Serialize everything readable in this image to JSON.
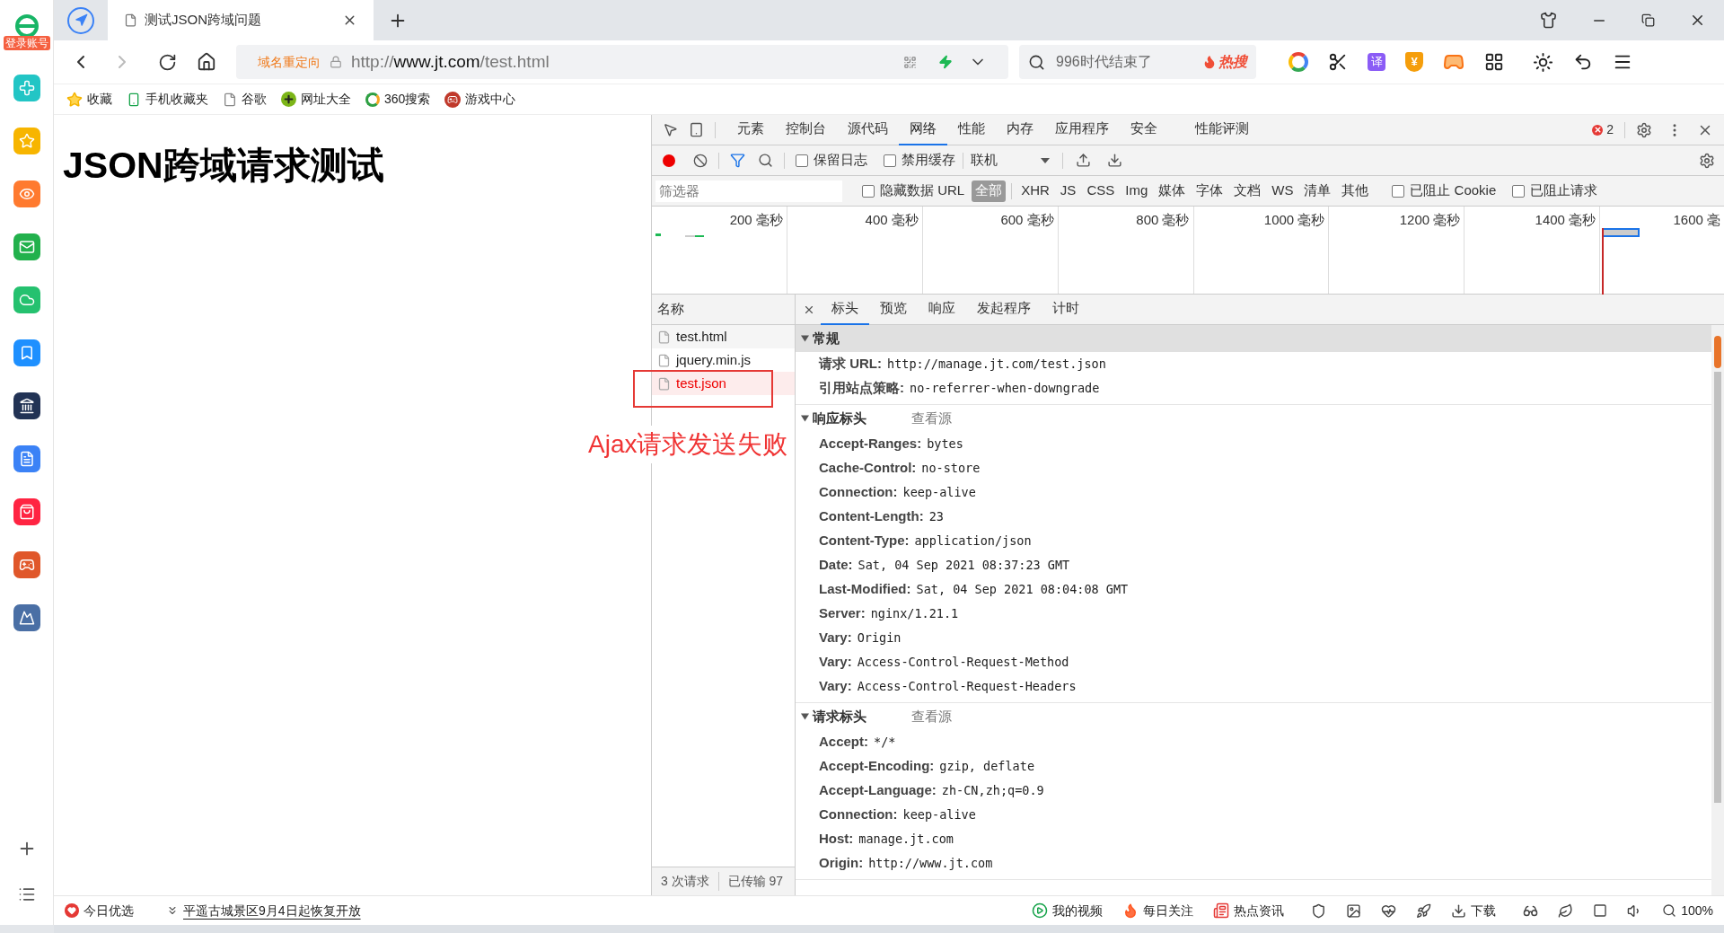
{
  "sidebar": {
    "login_badge": "登录账号"
  },
  "browser_tab": {
    "title": "测试JSON跨域问题"
  },
  "address_bar": {
    "redirect_label": "域名重定向",
    "url": {
      "scheme": "http://",
      "host": "www.jt.com",
      "path": "/test.html"
    }
  },
  "search_box": {
    "value": "996时代结束了",
    "hot_label": "热搜"
  },
  "toolbar": {
    "translate_label": "译",
    "wallet_label": "¥"
  },
  "bookmarks": [
    {
      "label": "收藏",
      "kind": "star"
    },
    {
      "label": "手机收藏夹",
      "kind": "phone"
    },
    {
      "label": "谷歌",
      "kind": "page"
    },
    {
      "label": "网址大全",
      "kind": "plus"
    },
    {
      "label": "360搜索",
      "kind": "ring"
    },
    {
      "label": "游戏中心",
      "kind": "game"
    }
  ],
  "page": {
    "heading": "JSON跨域请求测试"
  },
  "annotation": {
    "text": "Ajax请求发送失败"
  },
  "devtools": {
    "tabs": [
      {
        "label": "元素",
        "selected": false
      },
      {
        "label": "控制台",
        "selected": false
      },
      {
        "label": "源代码",
        "selected": false
      },
      {
        "label": "网络",
        "selected": true
      },
      {
        "label": "性能",
        "selected": false
      },
      {
        "label": "内存",
        "selected": false
      },
      {
        "label": "应用程序",
        "selected": false
      },
      {
        "label": "安全",
        "selected": false
      },
      {
        "label": "性能评测",
        "selected": false
      }
    ],
    "error_count": "2",
    "recording": true,
    "toolbar_checkboxes": [
      {
        "label": "保留日志",
        "checked": false
      },
      {
        "label": "禁用缓存",
        "checked": false
      }
    ],
    "throttle": "联机",
    "filter": {
      "placeholder": "筛选器",
      "hide_data_urls": {
        "label": "隐藏数据 URL",
        "checked": false
      },
      "types": [
        {
          "label": "全部",
          "selected": true
        },
        {
          "label": "XHR",
          "selected": false
        },
        {
          "label": "JS",
          "selected": false
        },
        {
          "label": "CSS",
          "selected": false
        },
        {
          "label": "Img",
          "selected": false
        },
        {
          "label": "媒体",
          "selected": false
        },
        {
          "label": "字体",
          "selected": false
        },
        {
          "label": "文档",
          "selected": false
        },
        {
          "label": "WS",
          "selected": false
        },
        {
          "label": "清单",
          "selected": false
        },
        {
          "label": "其他",
          "selected": false
        }
      ],
      "blocked": [
        {
          "label": "已阻止 Cookie",
          "checked": false
        },
        {
          "label": "已阻止请求",
          "checked": false
        }
      ]
    },
    "timeline_ticks": [
      "200 毫秒",
      "400 毫秒",
      "600 毫秒",
      "800 毫秒",
      "1000 毫秒",
      "1200 毫秒",
      "1400 毫秒",
      "1600 毫"
    ],
    "requests": {
      "column": "名称",
      "rows": [
        {
          "name": "test.html",
          "error": false
        },
        {
          "name": "jquery.min.js",
          "error": false
        },
        {
          "name": "test.json",
          "error": true
        }
      ],
      "summary": [
        "3 次请求",
        "已传输 97"
      ]
    },
    "detail_tabs": [
      {
        "label": "标头",
        "selected": true
      },
      {
        "label": "预览",
        "selected": false
      },
      {
        "label": "响应",
        "selected": false
      },
      {
        "label": "发起程序",
        "selected": false
      },
      {
        "label": "计时",
        "selected": false
      }
    ],
    "sections": [
      {
        "title": "常规",
        "expanded": true,
        "rows": [
          {
            "key": "请求 URL:",
            "value": "http://manage.jt.com/test.json"
          },
          {
            "key": "引用站点策略:",
            "value": "no-referrer-when-downgrade"
          }
        ]
      },
      {
        "title": "响应标头",
        "view_source": "查看源",
        "expanded": true,
        "rows": [
          {
            "key": "Accept-Ranges:",
            "value": "bytes"
          },
          {
            "key": "Cache-Control:",
            "value": "no-store"
          },
          {
            "key": "Connection:",
            "value": "keep-alive"
          },
          {
            "key": "Content-Length:",
            "value": "23"
          },
          {
            "key": "Content-Type:",
            "value": "application/json"
          },
          {
            "key": "Date:",
            "value": "Sat, 04 Sep 2021 08:37:23 GMT"
          },
          {
            "key": "Last-Modified:",
            "value": "Sat, 04 Sep 2021 08:04:08 GMT"
          },
          {
            "key": "Server:",
            "value": "nginx/1.21.1"
          },
          {
            "key": "Vary:",
            "value": "Origin"
          },
          {
            "key": "Vary:",
            "value": "Access-Control-Request-Method"
          },
          {
            "key": "Vary:",
            "value": "Access-Control-Request-Headers"
          }
        ]
      },
      {
        "title": "请求标头",
        "view_source": "查看源",
        "expanded": true,
        "rows": [
          {
            "key": "Accept:",
            "value": "*/*"
          },
          {
            "key": "Accept-Encoding:",
            "value": "gzip, deflate"
          },
          {
            "key": "Accept-Language:",
            "value": "zh-CN,zh;q=0.9"
          },
          {
            "key": "Connection:",
            "value": "keep-alive"
          },
          {
            "key": "Host:",
            "value": "manage.jt.com"
          },
          {
            "key": "Origin:",
            "value": "http://www.jt.com"
          }
        ]
      }
    ]
  },
  "status_bar": {
    "left": [
      {
        "label": "今日优选",
        "kind": "heart"
      },
      {
        "label": "平遥古城景区9月4日起恢复开放",
        "kind": "news"
      }
    ],
    "right": [
      {
        "label": "我的视频",
        "kind": "video"
      },
      {
        "label": "每日关注",
        "kind": "flame"
      },
      {
        "label": "热点资讯",
        "kind": "newspaper"
      },
      {
        "label": "下载",
        "kind": "download"
      },
      {
        "label": "100%",
        "kind": "zoom"
      }
    ]
  }
}
